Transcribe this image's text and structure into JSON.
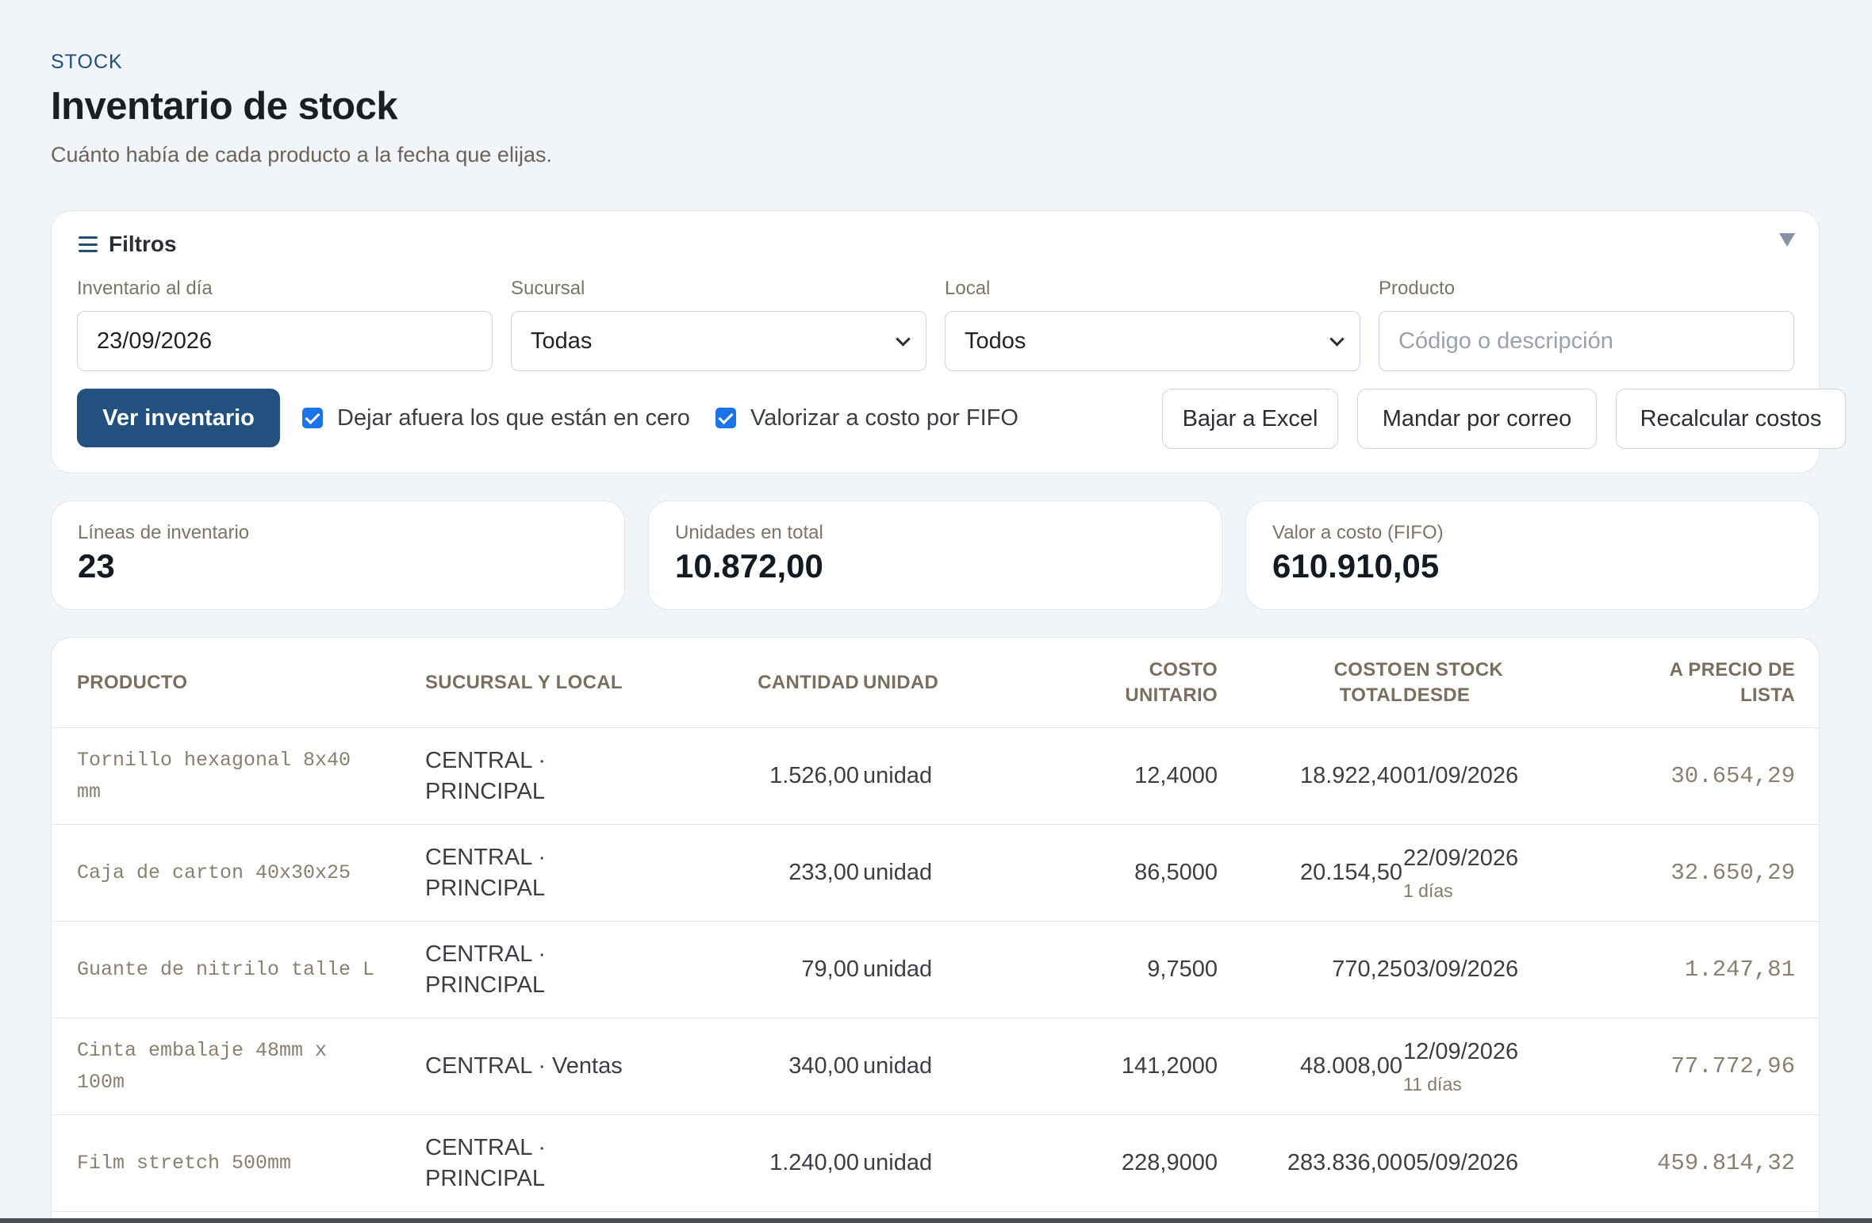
{
  "header": {
    "eyebrow": "STOCK",
    "title": "Inventario de stock",
    "subtitle": "Cuánto había de cada producto a la fecha que elijas."
  },
  "filters": {
    "title": "Filtros",
    "fields": {
      "date": {
        "label": "Inventario al día",
        "value": "23/09/2026"
      },
      "branch": {
        "label": "Sucursal",
        "value": "Todas"
      },
      "location": {
        "label": "Local",
        "value": "Todos"
      },
      "product": {
        "label": "Producto",
        "placeholder": "Código o descripción"
      }
    },
    "view_button": "Ver inventario",
    "exclude_zero_label": "Dejar afuera los que están en cero",
    "exclude_zero_checked": true,
    "fifo_label": "Valorizar a costo por FIFO",
    "fifo_checked": true,
    "export_excel": "Bajar a Excel",
    "send_email": "Mandar por correo",
    "recalculate": "Recalcular costos"
  },
  "stats": {
    "lines": {
      "label": "Líneas de inventario",
      "value": "23"
    },
    "units": {
      "label": "Unidades en total",
      "value": "10.872,00"
    },
    "value": {
      "label": "Valor a costo (FIFO)",
      "value": "610.910,05"
    }
  },
  "table": {
    "headers": {
      "product": "PRODUCTO",
      "branch_location": "SUCURSAL Y LOCAL",
      "quantity": "CANTIDAD",
      "unit": "UNIDAD",
      "unit_cost": "COSTO UNITARIO",
      "total_cost": "COSTO TOTAL",
      "in_stock_since": "EN STOCK DESDE",
      "list_price": "A PRECIO DE LISTA"
    },
    "rows": [
      {
        "product": "Tornillo hexagonal 8x40 mm",
        "branch": "CENTRAL · PRINCIPAL",
        "quantity": "1.526,00",
        "unit": "unidad",
        "unit_cost": "12,4000",
        "total_cost": "18.922,40",
        "since": "01/09/2026",
        "since_note": "",
        "list_price": "30.654,29"
      },
      {
        "product": "Caja de carton 40x30x25",
        "branch": "CENTRAL · PRINCIPAL",
        "quantity": "233,00",
        "unit": "unidad",
        "unit_cost": "86,5000",
        "total_cost": "20.154,50",
        "since": "22/09/2026",
        "since_note": "1 días",
        "list_price": "32.650,29"
      },
      {
        "product": "Guante de nitrilo talle L",
        "branch": "CENTRAL · PRINCIPAL",
        "quantity": "79,00",
        "unit": "unidad",
        "unit_cost": "9,7500",
        "total_cost": "770,25",
        "since": "03/09/2026",
        "since_note": "",
        "list_price": "1.247,81"
      },
      {
        "product": "Cinta embalaje 48mm x 100m",
        "branch": "CENTRAL · Ventas",
        "quantity": "340,00",
        "unit": "unidad",
        "unit_cost": "141,2000",
        "total_cost": "48.008,00",
        "since": "12/09/2026",
        "since_note": "11 días",
        "list_price": "77.772,96"
      },
      {
        "product": "Film stretch 500mm",
        "branch": "CENTRAL · PRINCIPAL",
        "quantity": "1.240,00",
        "unit": "unidad",
        "unit_cost": "228,9000",
        "total_cost": "283.836,00",
        "since": "05/09/2026",
        "since_note": "",
        "list_price": "459.814,32"
      }
    ]
  }
}
